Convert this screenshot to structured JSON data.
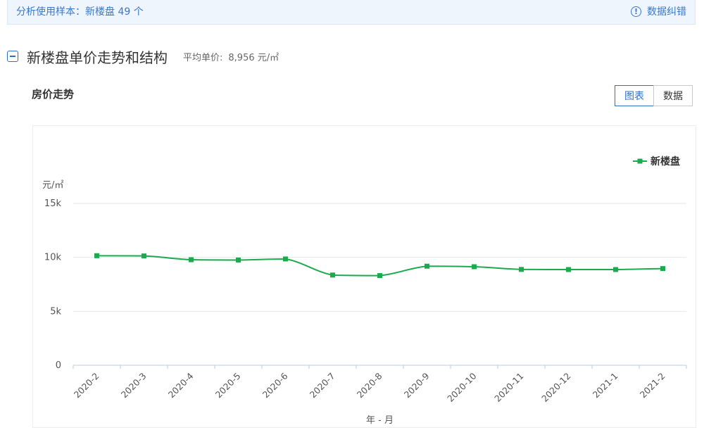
{
  "notice": {
    "sample_text": "分析使用样本：新楼盘 49 个",
    "correct_label": "数据纠错",
    "info_icon": "info-circle-icon"
  },
  "section": {
    "title": "新楼盘单价走势和结构",
    "avg_label": "平均单价:",
    "avg_value": "8,956 元/㎡",
    "collapse_icon": "minus-square-icon"
  },
  "trend": {
    "title": "房价走势",
    "tabs": [
      {
        "label": "图表",
        "active": true
      },
      {
        "label": "数据",
        "active": false
      }
    ]
  },
  "colors": {
    "accent": "#2d6fc3",
    "series": "#1bab4e",
    "notice_bg": "#eef5fd"
  },
  "chart_data": {
    "type": "line",
    "ylabel": "元/㎡",
    "xlabel": "年 - 月",
    "categories": [
      "2020-2",
      "2020-3",
      "2020-4",
      "2020-5",
      "2020-6",
      "2020-7",
      "2020-8",
      "2020-9",
      "2020-10",
      "2020-11",
      "2020-12",
      "2021-1",
      "2021-2"
    ],
    "series": [
      {
        "name": "新楼盘",
        "values": [
          10150,
          10130,
          9780,
          9750,
          9850,
          8360,
          8310,
          9180,
          9130,
          8880,
          8870,
          8870,
          8960
        ]
      }
    ],
    "ylim": [
      0,
      15000
    ],
    "yticks": [
      0,
      5000,
      10000,
      15000
    ],
    "ytick_labels": [
      "0",
      "5k",
      "10k",
      "15k"
    ],
    "grid": true,
    "legend": "top-right"
  }
}
